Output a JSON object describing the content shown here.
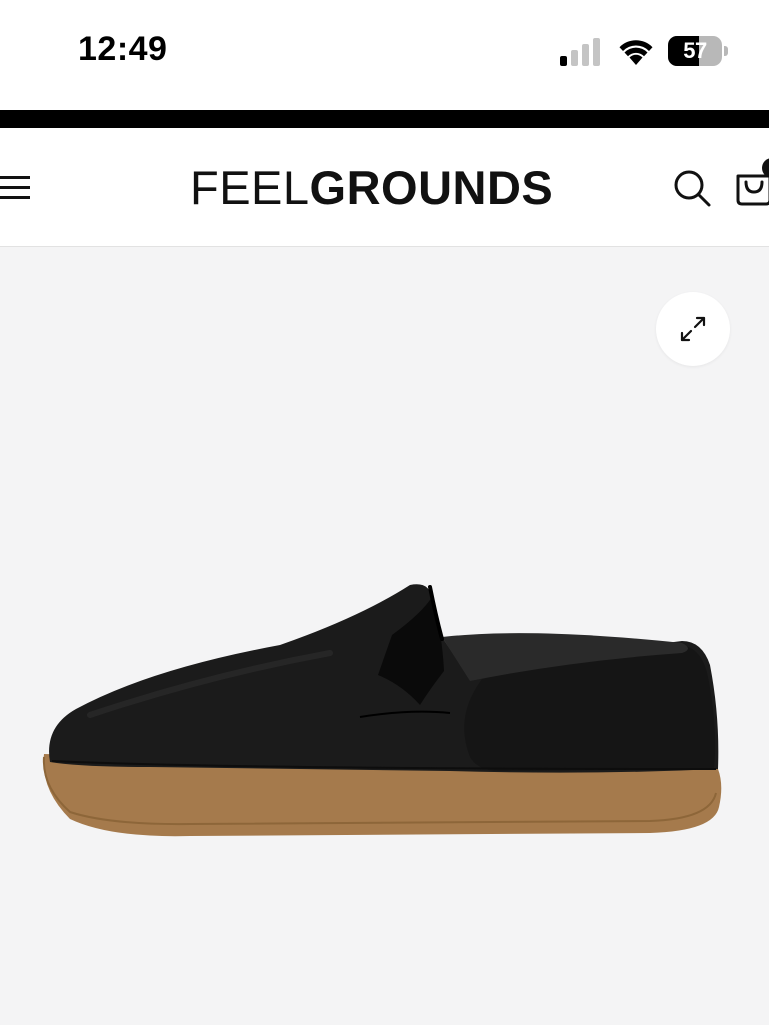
{
  "status_bar": {
    "time": "12:49",
    "battery_level": "57",
    "battery_fraction": 0.57,
    "signal_bars_active": 1,
    "signal_bars_total": 4
  },
  "header": {
    "logo_light": "FEEL",
    "logo_bold": "GROUNDS",
    "icons": {
      "menu": "menu-icon",
      "search": "search-icon",
      "cart": "cart-icon"
    }
  },
  "product": {
    "image": "black-slip-on-shoe-gum-sole",
    "expand_icon": "expand-icon",
    "colors": {
      "upper": "#1a1a1a",
      "sole": "#a57a4c",
      "background": "#f4f4f5"
    }
  }
}
